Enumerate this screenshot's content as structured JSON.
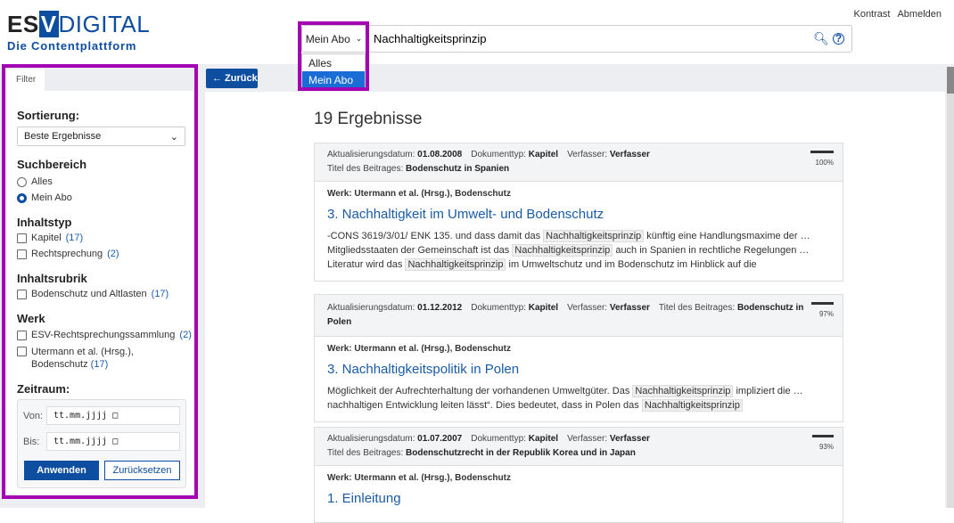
{
  "header": {
    "logo_es": "ES",
    "logo_v": "V",
    "logo_digital": "DIGITAL",
    "logo_tagline": "Die Contentplattform",
    "links": [
      "Kontrast",
      "Abmelden"
    ]
  },
  "search": {
    "scope": "Mein Abo",
    "value": "Nachhaltigkeitsprinzip",
    "scope_options": [
      "Alles",
      "Mein Abo"
    ],
    "selected_option": "Mein Abo"
  },
  "filter": {
    "tab": "Filter",
    "sort_label": "Sortierung:",
    "sort_value": "Beste Ergebnisse",
    "suchbereich_label": "Suchbereich",
    "suchbereich": [
      "Alles",
      "Mein Abo"
    ],
    "suchbereich_selected": "Mein Abo",
    "inhaltstyp_label": "Inhaltstyp",
    "inhaltstyp": [
      {
        "label": "Kapitel",
        "count": "(17)"
      },
      {
        "label": "Rechtsprechung",
        "count": "(2)"
      }
    ],
    "inhaltsrubrik_label": "Inhaltsrubrik",
    "inhaltsrubrik": [
      {
        "label": "Bodenschutz und Altlasten",
        "count": "(17)"
      }
    ],
    "werk_label": "Werk",
    "werk": [
      {
        "label": "ESV-Rechtsprechungssammlung",
        "count": "(2)"
      },
      {
        "label": "Utermann et al. (Hrsg.),",
        "label2": "Bodenschutz",
        "count": "(17)"
      }
    ],
    "zeitraum_label": "Zeitraum:",
    "von_label": "Von:",
    "bis_label": "Bis:",
    "date_placeholder": "tt.mm.jjjj",
    "apply": "Anwenden",
    "reset": "Zurücksetzen"
  },
  "back_label": "← Zurück",
  "results_count": "19 Ergebnisse",
  "results": [
    {
      "date_label": "Aktualisierungsdatum:",
      "date": "01.08.2008",
      "type_label": "Dokumenttyp:",
      "type": "Kapitel",
      "author_label": "Verfasser:",
      "author": "Verfasser",
      "titel_label": "Titel des Beitrages:",
      "titel": "Bodenschutz in Spanien",
      "score": "100%",
      "score_value": 100,
      "werk": "Werk: Utermann et al. (Hrsg.), Bodenschutz",
      "title": "3. Nachhaltigkeit im Umwelt- und Bodenschutz",
      "snippet": [
        [
          "-CONS 3619/3/01/ ENK 135. und dass damit das ",
          0
        ],
        [
          "Nachhaltigkeitsprinzip",
          1
        ],
        [
          " künftig eine Handlungsmaxime der  …  Mitgliedsstaaten der Gemeinschaft ist das ",
          0
        ],
        [
          "Nachhaltigkeitsprinzip",
          1
        ],
        [
          " auch in Spanien in rechtliche Regelungen  …  Literatur wird das ",
          0
        ],
        [
          "Nachhaltigkeitsprinzip",
          1
        ],
        [
          " im Umweltschutz und im Bodenschutz im Hinblick auf die",
          0
        ]
      ]
    },
    {
      "date_label": "Aktualisierungsdatum:",
      "date": "01.12.2012",
      "type_label": "Dokumenttyp:",
      "type": "Kapitel",
      "author_label": "Verfasser:",
      "author": "Verfasser",
      "titel_label": "Titel des Beitrages:",
      "titel": "Bodenschutz in Polen",
      "score": "97%",
      "score_value": 97,
      "werk": "Werk: Utermann et al. (Hrsg.), Bodenschutz",
      "title": "3. Nachhaltigkeitspolitik in Polen",
      "snippet": [
        [
          "Möglichkeit der Aufrechterhaltung der vorhandenen Umweltgüter. Das ",
          0
        ],
        [
          "Nachhaltigkeitsprinzip",
          1
        ],
        [
          " impliziert die  …  nachhaltigen Entwicklung leiten lässt“. Dies bedeutet, dass in Polen das ",
          0
        ],
        [
          "Nachhaltigkeitsprinzip",
          1
        ]
      ]
    },
    {
      "date_label": "Aktualisierungsdatum:",
      "date": "01.07.2007",
      "type_label": "Dokumenttyp:",
      "type": "Kapitel",
      "author_label": "Verfasser:",
      "author": "Verfasser",
      "titel_label": "Titel des Beitrages:",
      "titel": "Bodenschutzrecht in der Republik Korea und in Japan",
      "score": "93%",
      "score_value": 93,
      "werk": "Werk: Utermann et al. (Hrsg.), Bodenschutz",
      "title": "1. Einleitung",
      "snippet": []
    }
  ]
}
